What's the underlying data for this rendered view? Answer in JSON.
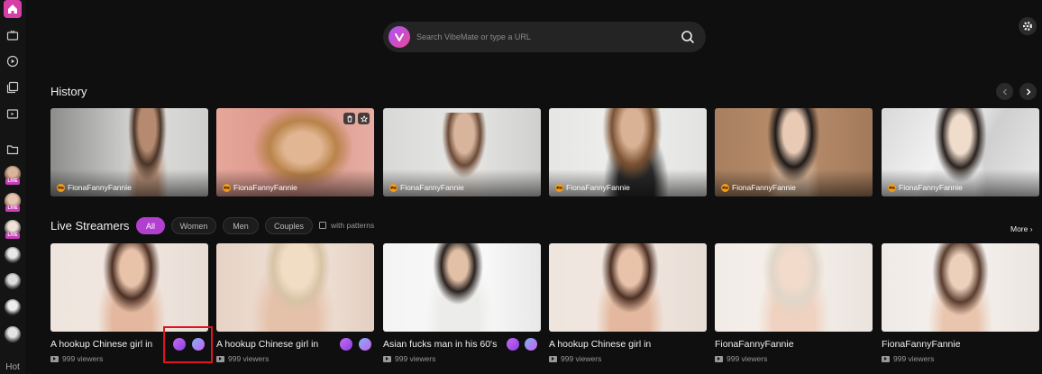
{
  "search": {
    "placeholder": "Search VibeMate or type a URL"
  },
  "sidebar": {
    "hot_label": "Hot",
    "live_label": "LIVE"
  },
  "history": {
    "title": "History",
    "cards": [
      {
        "name": "FionaFannyFannie",
        "badge": "PH"
      },
      {
        "name": "FionaFannyFannie",
        "badge": "PH"
      },
      {
        "name": "FionaFannyFannie",
        "badge": "PH"
      },
      {
        "name": "FionaFannyFannie",
        "badge": "PH"
      },
      {
        "name": "FionaFannyFannie",
        "badge": "PH"
      },
      {
        "name": "FionaFannyFannie",
        "badge": "PH"
      }
    ]
  },
  "live": {
    "title": "Live Streamers",
    "filters": [
      "All",
      "Women",
      "Men",
      "Couples"
    ],
    "pattern_label": "with patterns",
    "more_label": "More ›",
    "streams": [
      {
        "title": "A hookup Chinese girl in",
        "viewers": "999 viewers"
      },
      {
        "title": "A hookup Chinese girl in",
        "viewers": "999 viewers"
      },
      {
        "title": "Asian fucks man in his 60's",
        "viewers": "999 viewers"
      },
      {
        "title": "A hookup Chinese girl in",
        "viewers": "999 viewers"
      },
      {
        "title": "FionaFannyFannie",
        "viewers": "999 viewers"
      },
      {
        "title": "FionaFannyFannie",
        "viewers": "999 viewers"
      }
    ]
  },
  "colors": {
    "accent": "#b23fd0",
    "highlight": "#e0141e",
    "ph_badge": "#f29a1a"
  }
}
